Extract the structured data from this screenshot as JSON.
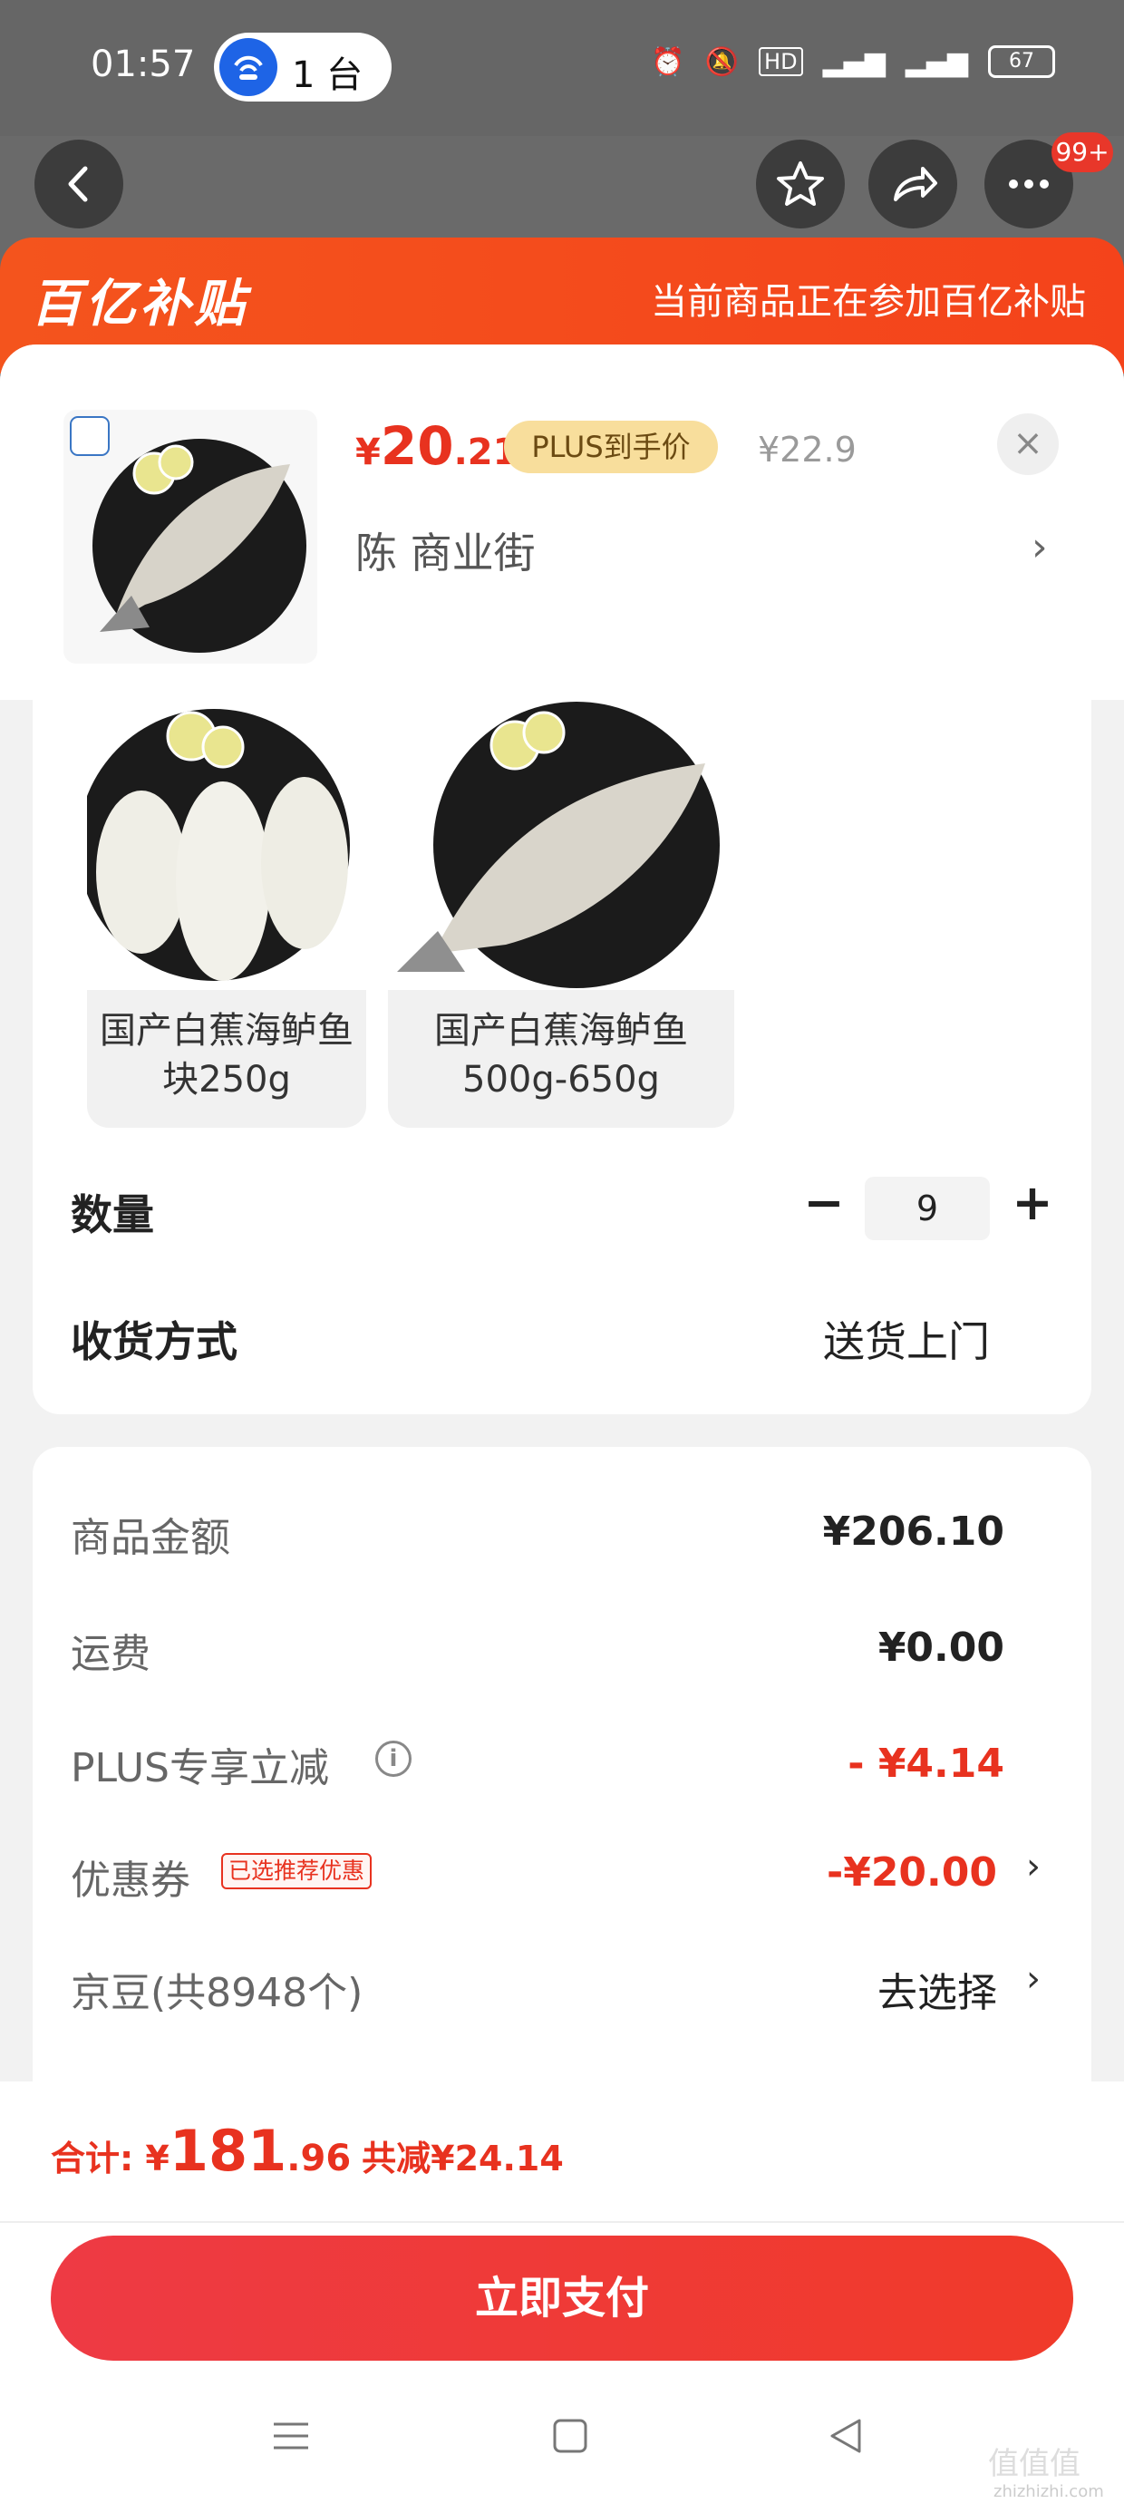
{
  "status": {
    "time": "01:57",
    "hotspot_label": "1 台",
    "battery": "67",
    "icons": [
      "alarm-icon",
      "mute-icon",
      "hd-icon",
      "signal-4g-icon",
      "signal-4g-icon",
      "battery-icon"
    ]
  },
  "nav": {
    "badge": "99+"
  },
  "banner": {
    "brand": "百亿补贴",
    "note": "当前商品正在参加百亿补贴"
  },
  "product": {
    "price_symbol": "¥",
    "price_int": "20",
    "price_dec": ".21",
    "plus_tag": "PLUS到手价",
    "original_price": "¥22.9",
    "shop": "陈  商业街",
    "shop_arrow": "›",
    "close": "×"
  },
  "options": [
    {
      "label": "国产白蕉海鲈鱼块250g"
    },
    {
      "label": "国产白蕉海鲈鱼500g-650g"
    }
  ],
  "quantity": {
    "label": "数量",
    "minus": "−",
    "value": "9",
    "plus": "+"
  },
  "shipping": {
    "label": "收货方式",
    "value": "送货上门"
  },
  "summary": {
    "goods_label": "商品金额",
    "goods_value": "¥206.10",
    "freight_label": "运费",
    "freight_value": "¥0.00",
    "plus_label": "PLUS专享立减",
    "plus_value": "- ¥4.14",
    "coupon_label": "优惠券",
    "coupon_tag": "已选推荐优惠",
    "coupon_value": "-¥20.00",
    "jingdou_label": "京豆(共8948个)",
    "jingdou_value": "去选择",
    "chevron": "›"
  },
  "footer": {
    "total_label": "合计: ¥",
    "total_int": "181",
    "total_dec": ".96",
    "reduce": "共减¥24.14",
    "pay": "立即支付"
  },
  "watermark": {
    "main": "值值值",
    "sub": "zhizhizhi.com"
  },
  "colors": {
    "accent_red": "#e8321f",
    "banner_orange": "#f4541d",
    "pay_button": "#ee3a44"
  }
}
